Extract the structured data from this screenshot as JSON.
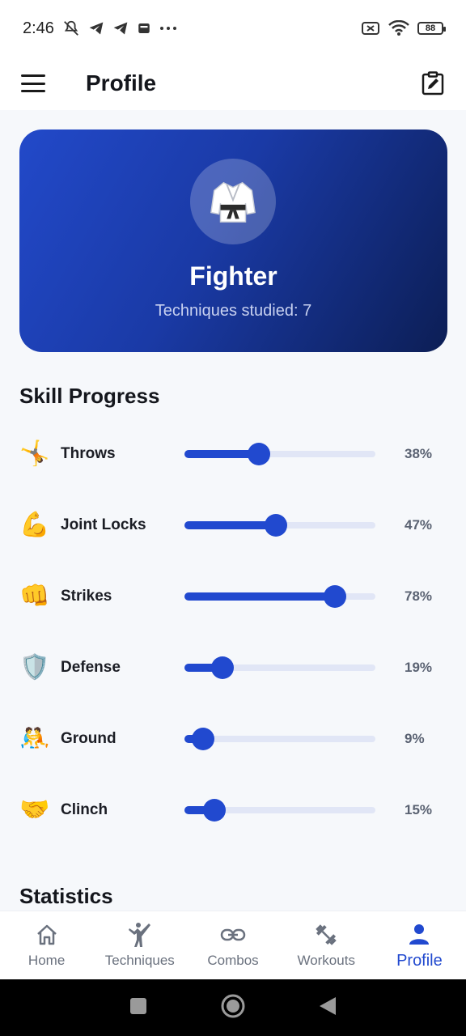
{
  "status_bar": {
    "time": "2:46",
    "battery": "88",
    "icons": [
      "mute-icon",
      "telegram-icon",
      "telegram-icon",
      "sim-icon",
      "more-dots-icon",
      "no-sim-icon",
      "wifi-icon",
      "battery-icon"
    ]
  },
  "app_bar": {
    "title": "Profile"
  },
  "profile": {
    "avatar_emoji": "🥋",
    "name": "Fighter",
    "subtitle": "Techniques studied: 7"
  },
  "skills_section": {
    "title": "Skill Progress",
    "items": [
      {
        "emoji": "🤸",
        "name": "Throws",
        "value": 38,
        "label": "38%"
      },
      {
        "emoji": "💪",
        "name": "Joint Locks",
        "value": 47,
        "label": "47%"
      },
      {
        "emoji": "👊",
        "name": "Strikes",
        "value": 78,
        "label": "78%"
      },
      {
        "emoji": "🛡️",
        "name": "Defense",
        "value": 19,
        "label": "19%"
      },
      {
        "emoji": "🤼",
        "name": "Ground",
        "value": 9,
        "label": "9%"
      },
      {
        "emoji": "🤝",
        "name": "Clinch",
        "value": 15,
        "label": "15%"
      }
    ]
  },
  "statistics_section": {
    "title": "Statistics"
  },
  "bottom_nav": {
    "items": [
      {
        "label": "Home",
        "icon": "home-icon",
        "active": false
      },
      {
        "label": "Techniques",
        "icon": "martial-arts-icon",
        "active": false
      },
      {
        "label": "Combos",
        "icon": "link-icon",
        "active": false
      },
      {
        "label": "Workouts",
        "icon": "dumbbell-icon",
        "active": false
      },
      {
        "label": "Profile",
        "icon": "person-icon",
        "active": true
      }
    ]
  },
  "colors": {
    "accent": "#2149cf",
    "track": "#e1e6f6",
    "card_start": "#2249c9",
    "card_end": "#0c1e55"
  }
}
